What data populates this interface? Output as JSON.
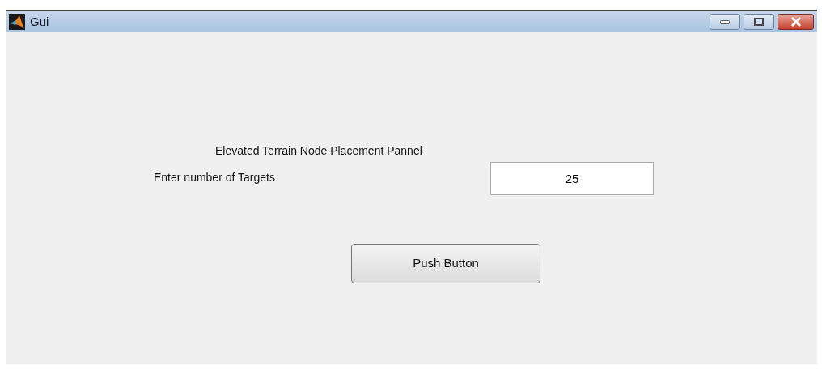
{
  "window": {
    "title": "Gui"
  },
  "heading": "Elevated Terrain Node Placement Pannel",
  "targets": {
    "label": "Enter number of Targets",
    "value": "25"
  },
  "button": "Push Button"
}
